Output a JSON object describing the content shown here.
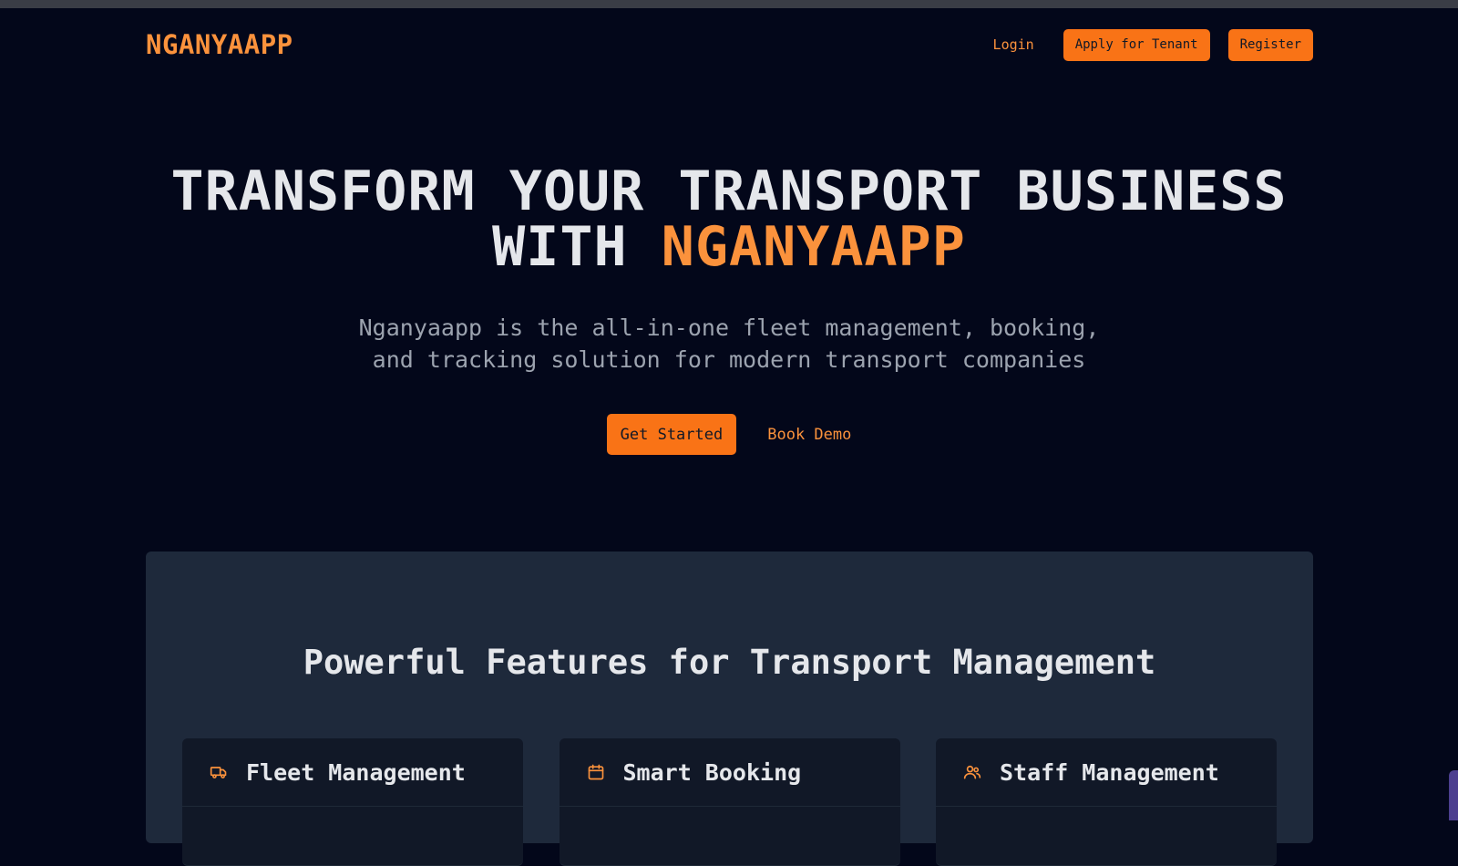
{
  "nav": {
    "logo": "NGANYAAPP",
    "login": "Login",
    "apply_tenant": "Apply for Tenant",
    "register": "Register"
  },
  "hero": {
    "title_line1": "TRANSFORM YOUR TRANSPORT BUSINESS",
    "title_with": "WITH",
    "title_brand": "NGANYAAPP",
    "subtitle": "Nganyaapp is the all-in-one fleet management, booking, and tracking solution for modern transport companies",
    "cta_primary": "Get Started",
    "cta_secondary": "Book Demo"
  },
  "features": {
    "title": "Powerful Features for Transport Management",
    "cards": [
      {
        "icon": "truck-icon",
        "title": "Fleet Management"
      },
      {
        "icon": "calendar-icon",
        "title": "Smart Booking"
      },
      {
        "icon": "users-icon",
        "title": "Staff Management"
      }
    ]
  },
  "colors": {
    "accent": "#f97316",
    "accent_text": "#fb923c",
    "background": "#03071a",
    "panel": "#1e293b",
    "card": "#111827"
  }
}
